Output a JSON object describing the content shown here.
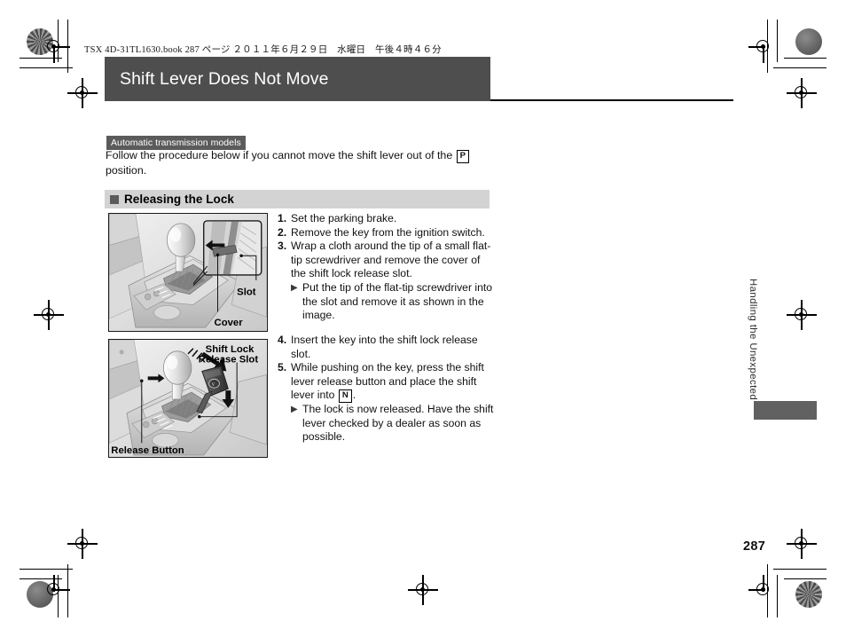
{
  "print_header": "TSX 4D-31TL1630.book  287 ページ  ２０１１年６月２９日　水曜日　午後４時４６分",
  "title_bar": {
    "title": "Shift Lever Does Not Move"
  },
  "badge": {
    "label": "Automatic transmission models"
  },
  "intro": {
    "part1": "Follow the procedure below if you cannot move the shift lever out of the",
    "gear_box": "P",
    "part2": "position."
  },
  "section": {
    "heading": "Releasing the Lock"
  },
  "illustrations": [
    {
      "name": "shift-lever-cover-illustration",
      "labels": [
        "Slot",
        "Cover"
      ]
    },
    {
      "name": "shift-lock-release-illustration",
      "labels": [
        "Shift Lock",
        "Release Slot",
        "Release Button"
      ]
    }
  ],
  "steps_group_1": [
    {
      "num": "1.",
      "text": "Set the parking brake."
    },
    {
      "num": "2.",
      "text": "Remove the key from the ignition switch."
    },
    {
      "num": "3.",
      "text": "Wrap a cloth around the tip of a small flat-tip screwdriver and remove the cover of the shift lock release slot."
    }
  ],
  "sub_bullet_1": {
    "marker": "▶",
    "text": "Put the tip of the flat-tip screwdriver into the slot and remove it as shown in the image."
  },
  "steps_group_2": [
    {
      "num": "4.",
      "text": "Insert the key into the shift lock release slot."
    }
  ],
  "step_5": {
    "num": "5.",
    "text_part1": "While pushing on the key, press the shift lever release button and place the shift lever into",
    "gear_box": "N",
    "text_part2": "."
  },
  "sub_bullet_2": {
    "marker": "▶",
    "text": "The lock is now released. Have the shift lever checked by a dealer as soon as possible."
  },
  "right_margin": {
    "chapter": "Handling the Unexpected",
    "page_number": "287"
  },
  "colors": {
    "title_bar_bg": "#4e4e4e",
    "badge_bg": "#5b5b5b",
    "section_bar_bg": "#d3d3d3",
    "thumb_tab_bg": "#616161"
  }
}
